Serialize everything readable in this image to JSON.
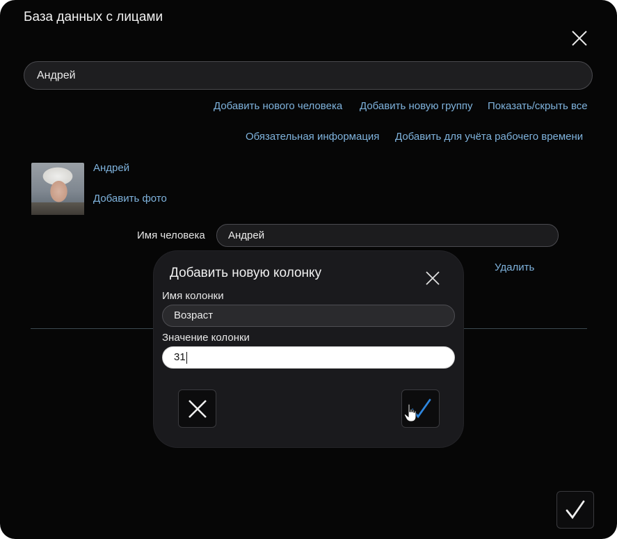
{
  "window": {
    "title": "База данных с лицами"
  },
  "search": {
    "value": "Андрей"
  },
  "links_row1": {
    "add_person": "Добавить нового человека",
    "add_group": "Добавить новую группу",
    "toggle_all": "Показать/скрыть все"
  },
  "links_row2": {
    "required_info": "Обязательная информация",
    "add_work_time": "Добавить для учёта рабочего времени"
  },
  "person": {
    "name_link": "Андрей",
    "add_photo": "Добавить фото",
    "name_label": "Имя человека",
    "name_value": "Андрей",
    "delete": "Удалить"
  },
  "dialog": {
    "title": "Добавить новую колонку",
    "column_name_label": "Имя колонки",
    "column_name_value": "Возраст",
    "column_value_label": "Значение колонки",
    "column_value_value": "31"
  },
  "colors": {
    "background": "#060606",
    "link": "#7fb3dd",
    "confirm_check": "#2e86de"
  },
  "icons": [
    "close-icon",
    "cancel-x-icon",
    "checkmark-icon",
    "hand-cursor-icon"
  ]
}
